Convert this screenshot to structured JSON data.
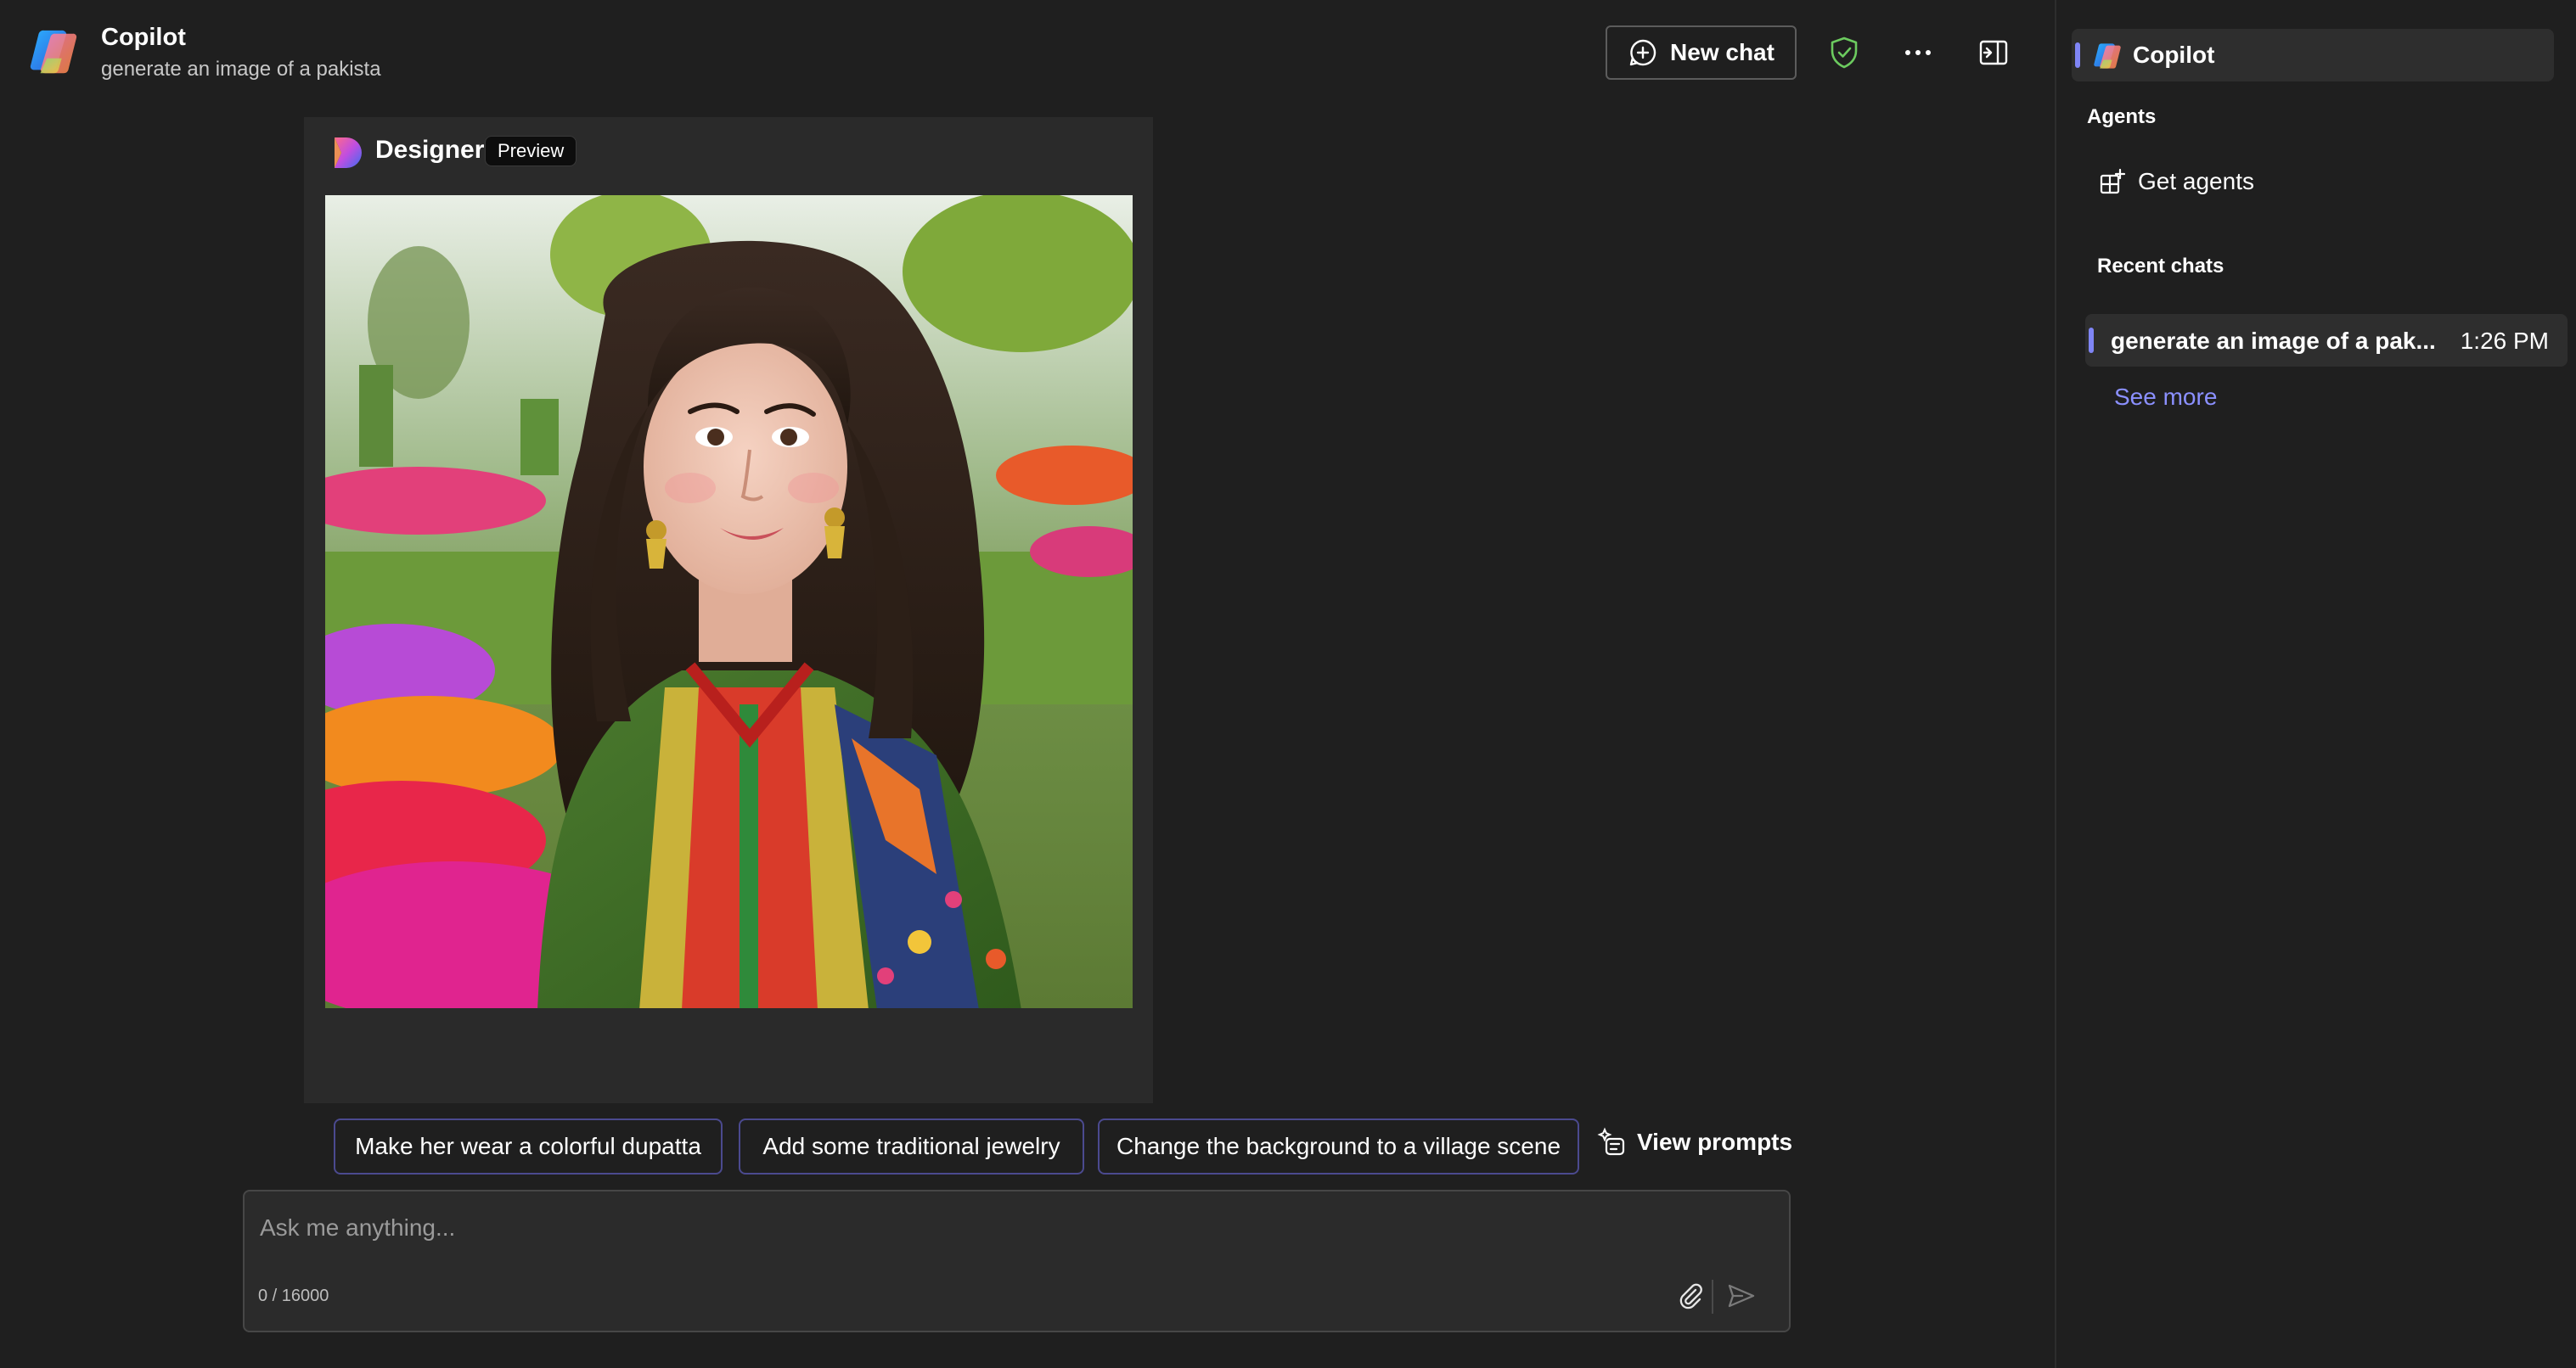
{
  "header": {
    "app_title": "Copilot",
    "subtitle": "generate an image of a pakista",
    "new_chat_label": "New chat",
    "icons": [
      "copilot-logo-icon",
      "new-chat-icon",
      "shield-check-icon",
      "more-options-icon",
      "side-panel-icon"
    ]
  },
  "message": {
    "source_name": "Designer",
    "badge": "Preview",
    "image_subject": "generated-portrait-image"
  },
  "suggestions": [
    {
      "label": "Make her wear a colorful dupatta"
    },
    {
      "label": "Add some traditional jewelry"
    },
    {
      "label": "Change the background to a village scene"
    }
  ],
  "view_prompts_label": "View prompts",
  "composer": {
    "placeholder": "Ask me anything...",
    "char_count": "0 / 16000"
  },
  "sidebar": {
    "copilot_label": "Copilot",
    "agents_heading": "Agents",
    "get_agents_label": "Get agents",
    "recent_heading": "Recent chats",
    "recent_items": [
      {
        "title": "generate an image of a pak...",
        "time": "1:26 PM"
      }
    ],
    "see_more_label": "See more"
  },
  "colors": {
    "background": "#1f1f1f",
    "card": "#2a2a2a",
    "accent": "#7f85f5",
    "suggestion_border": "#4b4a8f",
    "link": "#8b90ff",
    "shield_green": "#6ccb5f"
  }
}
